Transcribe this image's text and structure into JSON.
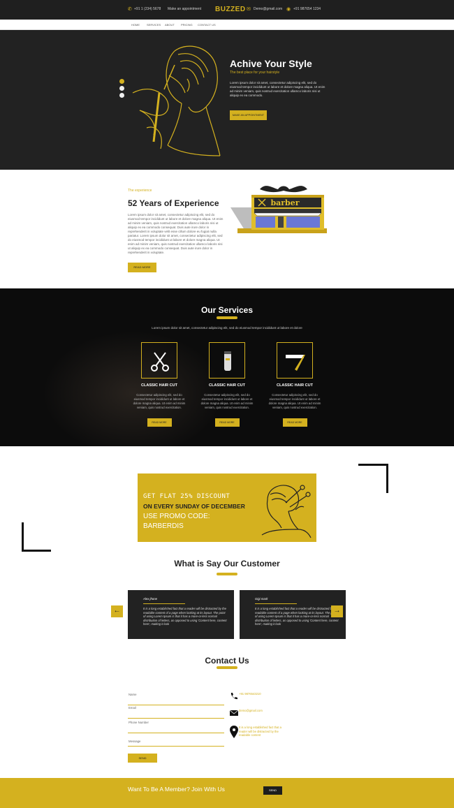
{
  "topbar": {
    "phone": "+91 1 (234) 5678",
    "appointment": "Make an appointment",
    "brand": "BUZZED",
    "email": "Demo@gmail.com",
    "location": "+91 987654 1234"
  },
  "nav": {
    "items": [
      "Home",
      "Services",
      "About",
      "Pricing",
      "Contact Us"
    ]
  },
  "hero": {
    "title": "Achive Your Style",
    "subtitle": "The best place for your hairstyle",
    "text": "Lorem ipsum dolor sit amet, consectetur adipiscing elit, sed do eiusmod tempor incididunt ut labore et dolore magna aliqua. Ut enim ad minim veniam, quis nostrud exercitation ullamco laboris nisi ut aliquip ex ea commodo.",
    "button": "MAKE AN APPOINTMENT",
    "slides": 3,
    "active_slide": 1
  },
  "about": {
    "kicker": "The experience",
    "title": "52 Years of Experience",
    "text": "Lorem ipsum dolor sit amet, consectetur adipiscing elit, sed do eiusmod tempor incididunt ut labore et dolore magna aliqua. Ut enim ad minim veniam, quis nostrud exercitation ullamco laboris nisi ut aliquip ex ea commodo consequat. Duis aute irure dolor in reprehenderit in voluptate velit esse cillum dolore eu fugiat nulla pariatur. Lorem ipsum dolor sit amet, consectetur adipiscing elit, sed do eiusmod tempor incididunt ut labore et dolore magna aliqua. Ut enim ad minim veniam, quis nostrud exercitation ullamco laboris nisi ut aliquip ex ea commodo consequat. Duis aute irure dolor in reprehenderit in voluptate.",
    "button": "READ MORE",
    "sign": "barber"
  },
  "services": {
    "title": "Our Services",
    "lead": "Lorem ipsum dolor sit amet, consectetur adipiscing elit, sed do eiusmod tempor incididunt ut labore et dolore",
    "items": [
      {
        "name": "CLASSIC HAIR CUT",
        "icon": "scissors-icon",
        "desc": "Consectetur adipiscing elit, sed do eiusmod tempor incididunt ut labore et dolore magna aliqua. Ut enim ad minim veniam, quis nostrud exercitation.",
        "button": "READ MORE"
      },
      {
        "name": "CLASSIC HAIR CUT",
        "icon": "trimmer-icon",
        "desc": "Consectetur adipiscing elit, sed do eiusmod tempor incididunt ut labore et dolore magna aliqua. Ut enim ad minim veniam, quis nostrud exercitation.",
        "button": "READ MORE"
      },
      {
        "name": "CLASSIC HAIR CUT",
        "icon": "razor-icon",
        "desc": "Consectetur adipiscing elit, sed do eiusmod tempor incididunt ut labore et dolore magna aliqua. Ut enim ad minim veniam, quis nostrud exercitation.",
        "button": "READ MORE"
      }
    ]
  },
  "promo": {
    "line1": "GET FLAT 25% DISCOUNT",
    "line2": "ON EVERY SUNDAY OF DECEMBER",
    "line3": "USE PROMO CODE:",
    "line4": "BARBERDIS"
  },
  "testimonials": {
    "title": "What is Say Our Customer",
    "prev": "←",
    "next": "→",
    "items": [
      {
        "name": "Alex jhone",
        "quote": "It is a long established fact that a reader will be distracted by the readable content of a page when looking at its layout. The point of using Lorem Ipsum is that it has a more-or-less normal distribution of letters, as opposed to using 'Content here, content here', making it look"
      },
      {
        "name": "Gigi mark",
        "quote": "It is a long established fact that a reader will be distracted by the readable content of a page when looking at its layout. The point of using Lorem Ipsum is that it has a more-or-less normal distribution of letters, as opposed to using 'Content here, content here', making it look"
      }
    ]
  },
  "contact": {
    "title": "Contact Us",
    "fields": [
      "Name",
      "Email",
      "Phone Number",
      "Message"
    ],
    "send": "SEND",
    "phone": "+91 9876543210",
    "email": "demo@gmail.com",
    "address": "It is a long established fact that a reader will be distracted by the readable content"
  },
  "footer": {
    "text": "Want To Be A Member? Join With Us",
    "button": "SEND"
  },
  "colors": {
    "accent": "#d4b11f",
    "dark": "#1f1f1f"
  }
}
